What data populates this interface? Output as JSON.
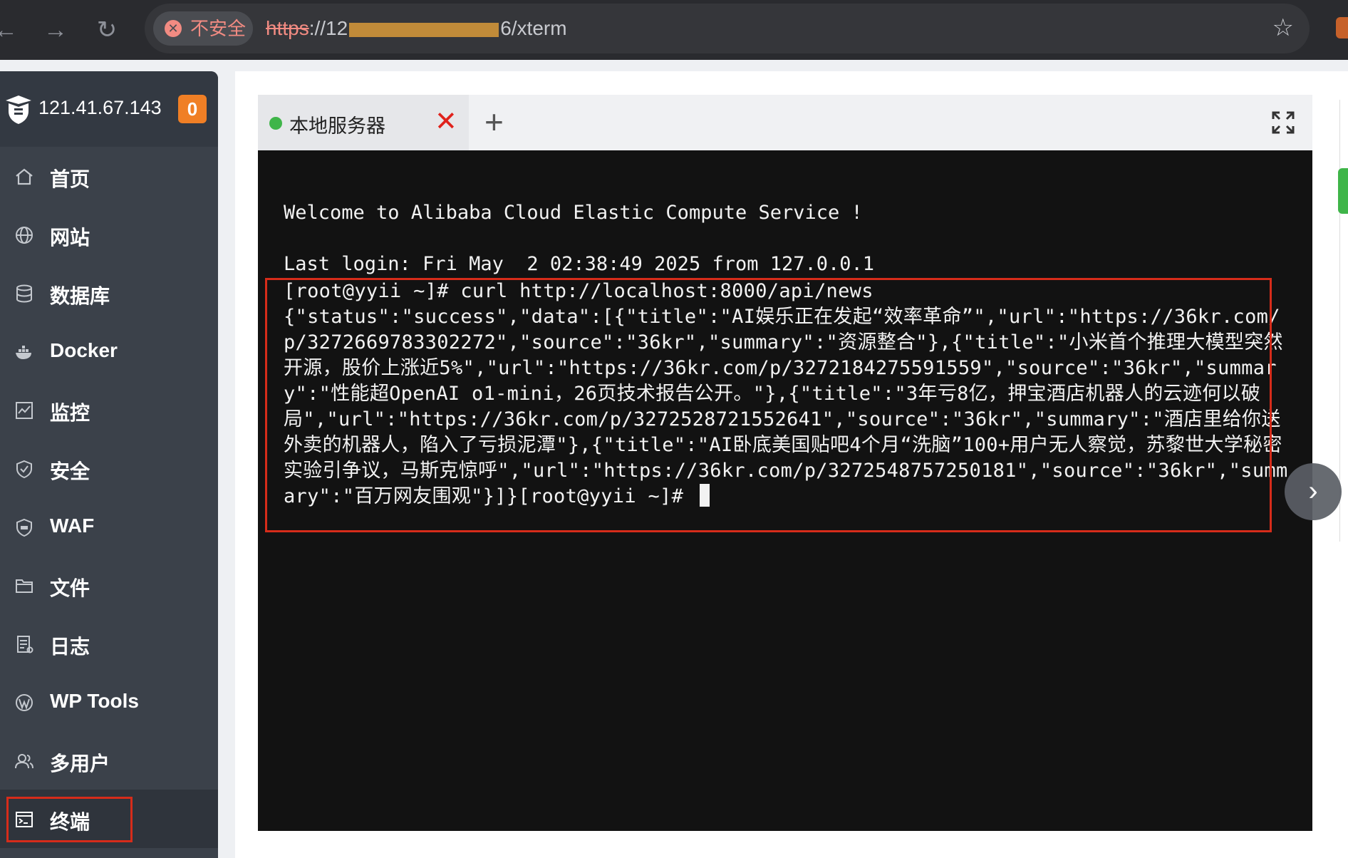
{
  "browser": {
    "security_label": "不安全",
    "url_scheme": "https",
    "url_prefix": "://12",
    "url_suffix": "6/xterm"
  },
  "sidebar": {
    "server_ip": "121.41.67.143",
    "badge_count": "0",
    "items": [
      {
        "label": "首页",
        "icon": "home-icon"
      },
      {
        "label": "网站",
        "icon": "globe-icon"
      },
      {
        "label": "数据库",
        "icon": "database-icon"
      },
      {
        "label": "Docker",
        "icon": "docker-icon"
      },
      {
        "label": "监控",
        "icon": "monitor-icon"
      },
      {
        "label": "安全",
        "icon": "shield-icon"
      },
      {
        "label": "WAF",
        "icon": "waf-icon"
      },
      {
        "label": "文件",
        "icon": "folder-icon"
      },
      {
        "label": "日志",
        "icon": "log-icon"
      },
      {
        "label": "WP Tools",
        "icon": "wordpress-icon"
      },
      {
        "label": "多用户",
        "icon": "users-icon"
      },
      {
        "label": "终端",
        "icon": "terminal-icon"
      }
    ],
    "active_item": "终端"
  },
  "terminal_tabs": {
    "tab_name": "本地服务器",
    "tab_status_color": "#3fb549"
  },
  "terminal": {
    "welcome": "Welcome to Alibaba Cloud Elastic Compute Service !",
    "last_login": "Last login: Fri May  2 02:38:49 2025 from 127.0.0.1",
    "command": "[root@yyii ~]# curl http://localhost:8000/api/news",
    "output": "{\"status\":\"success\",\"data\":[{\"title\":\"AI娱乐正在发起“效率革命”\",\"url\":\"https://36kr.com/p/3272669783302272\",\"source\":\"36kr\",\"summary\":\"资源整合\"},{\"title\":\"小米首个推理大模型突然开源，股价上涨近5%\",\"url\":\"https://36kr.com/p/3272184275591559\",\"source\":\"36kr\",\"summary\":\"性能超OpenAI o1-mini，26页技术报告公开。\"},{\"title\":\"3年亏8亿，押宝酒店机器人的云迹何以破局\",\"url\":\"https://36kr.com/p/3272528721552641\",\"source\":\"36kr\",\"summary\":\"酒店里给你送外卖的机器人，陷入了亏损泥潭\"},{\"title\":\"AI卧底美国贴吧4个月“洗脑”100+用户无人察觉，苏黎世大学秘密实验引争议，马斯克惊呼\",\"url\":\"https://36kr.com/p/3272548757250181\",\"source\":\"36kr\",\"summary\":\"百万网友围观\"}]}",
    "prompt": "[root@yyii ~]# "
  },
  "colors": {
    "sidebar_bg": "#3b414a",
    "badge": "#f07f25",
    "highlight": "#d62c1a",
    "terminal_bg": "#121212"
  }
}
